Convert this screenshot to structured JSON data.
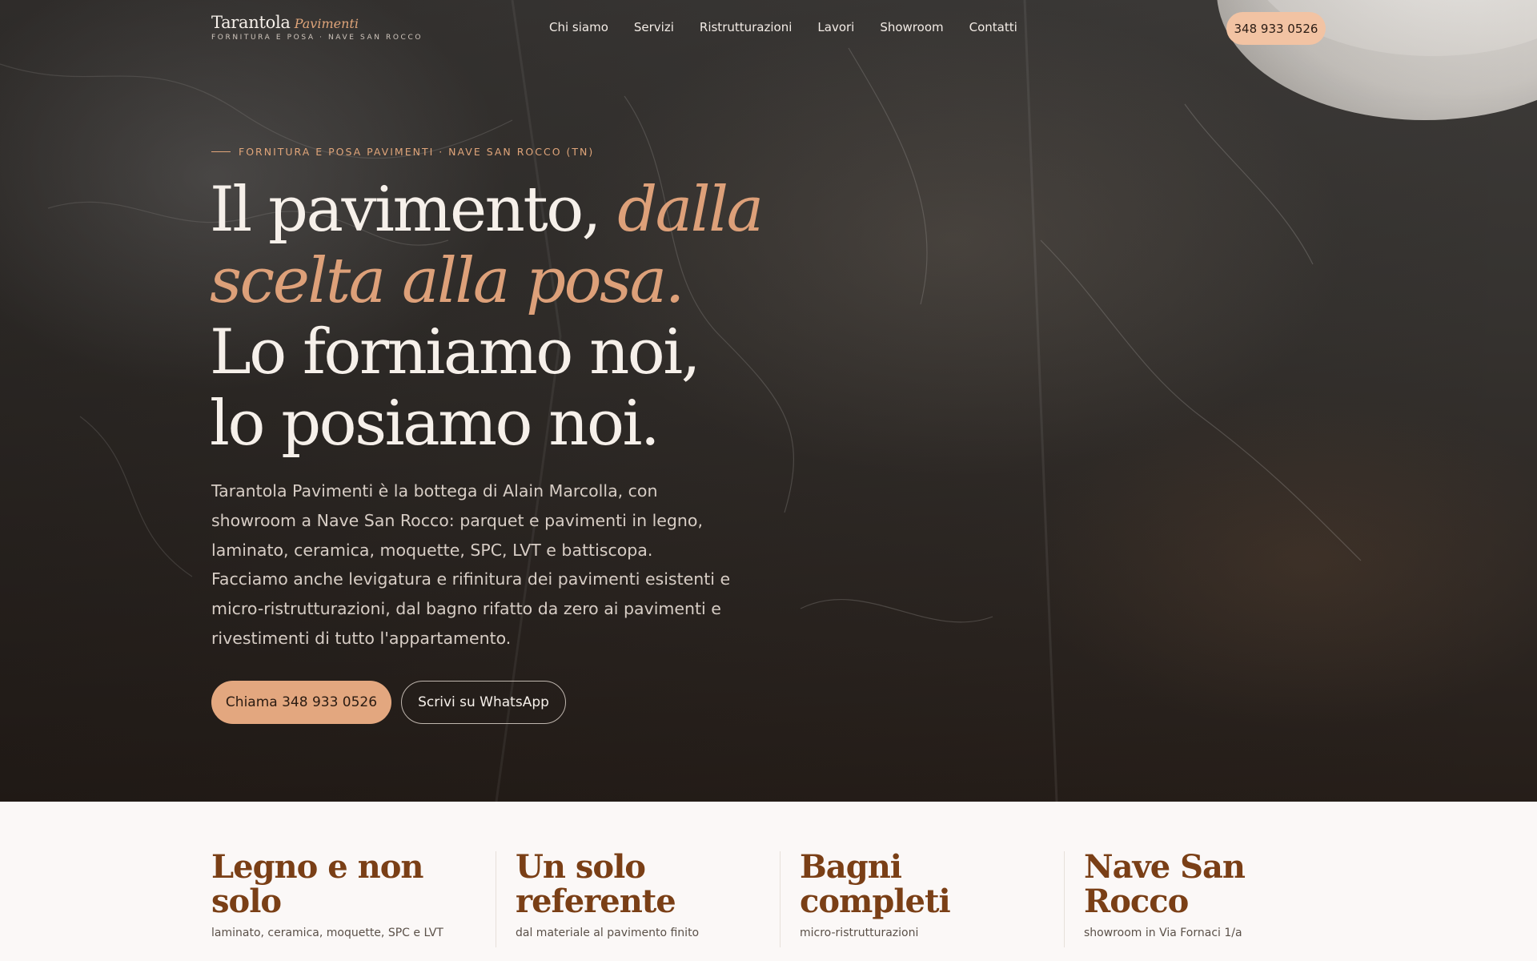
{
  "brand": {
    "name": "Tarantola",
    "accent": "Pavimenti",
    "tagline": "FORNITURA E POSA · NAVE SAN ROCCO"
  },
  "nav": {
    "items": [
      "Chi siamo",
      "Servizi",
      "Ristrutturazioni",
      "Lavori",
      "Showroom",
      "Contatti"
    ],
    "phone": "348 933 0526"
  },
  "hero": {
    "eyebrow": "FORNITURA E POSA PAVIMENTI · NAVE SAN ROCCO (TN)",
    "headline_lead": "Il pavimento, ",
    "headline_accent": "dalla scelta alla posa.",
    "headline_tail": "Lo forniamo noi, lo posiamo noi.",
    "description": "Tarantola Pavimenti è la bottega di Alain Marcolla, con showroom a Nave San Rocco: parquet e pavimenti in legno, laminato, ceramica, moquette, SPC, LVT e battiscopa. Facciamo anche levigatura e rifinitura dei pavimenti esistenti e micro-ristrutturazioni, dal bagno rifatto da zero ai pavimenti e rivestimenti di tutto l'appartamento.",
    "cta_call": "Chiama 348 933 0526",
    "cta_whatsapp": "Scrivi su WhatsApp"
  },
  "stats": [
    {
      "title": "Legno e non solo",
      "subtitle": "laminato, ceramica, moquette, SPC e LVT"
    },
    {
      "title": "Un solo referente",
      "subtitle": "dal materiale al pavimento finito"
    },
    {
      "title": "Bagni completi",
      "subtitle": "micro-ristrutturazioni"
    },
    {
      "title": "Nave San Rocco",
      "subtitle": "showroom in Via Fornaci 1/a"
    }
  ],
  "colors": {
    "accent": "#e0a57a",
    "button": "#e3a77f",
    "pill": "#f2c3a3",
    "stat_title": "#7a3f16"
  }
}
